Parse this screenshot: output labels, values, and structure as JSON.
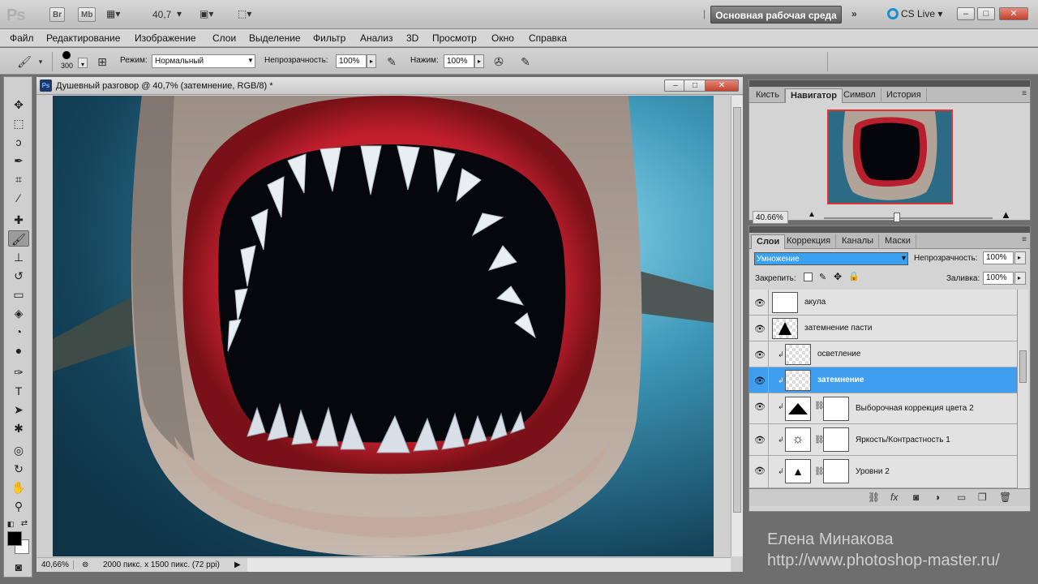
{
  "app": {
    "logo": "Ps",
    "bridge_badge": "Br",
    "mini_bridge_badge": "Mb",
    "zoom": "40,7",
    "workspace": "Основная рабочая среда",
    "cs_live": "CS Live"
  },
  "menu": [
    "Файл",
    "Редактирование",
    "Изображение",
    "Слои",
    "Выделение",
    "Фильтр",
    "Анализ",
    "3D",
    "Просмотр",
    "Окно",
    "Справка"
  ],
  "options": {
    "brush_size": "300",
    "mode_label": "Режим:",
    "mode_value": "Нормальный",
    "opacity_label": "Непрозрачность:",
    "opacity_value": "100%",
    "pressure_label": "Нажим:",
    "pressure_value": "100%"
  },
  "document": {
    "title": "Душевный разговор @ 40,7% (затемнение, RGB/8) *",
    "status_zoom": "40,66%",
    "status_info": "2000 пикс. x 1500 пикс. (72 ppi)"
  },
  "navigator_panel": {
    "tabs": [
      "Кисть",
      "Навигатор",
      "Символ",
      "История"
    ],
    "active_tab": "Навигатор",
    "zoom": "40.66%"
  },
  "layers_panel": {
    "tabs": [
      "Слои",
      "Коррекция",
      "Каналы",
      "Маски"
    ],
    "active_tab": "Слои",
    "blend_mode": "Умножение",
    "opacity_label": "Непрозрачность:",
    "opacity_value": "100%",
    "lock_label": "Закрепить:",
    "fill_label": "Заливка:",
    "fill_value": "100%",
    "layers": [
      {
        "name": "акула",
        "type": "pixel",
        "selected": false
      },
      {
        "name": "затемнение пасти",
        "type": "pixel",
        "selected": false
      },
      {
        "name": "осветление",
        "type": "clipped",
        "selected": false
      },
      {
        "name": "затемнение",
        "type": "clipped",
        "selected": true
      },
      {
        "name": "Выборочная коррекция цвета 2",
        "type": "adjustment",
        "selected": false
      },
      {
        "name": "Яркость/Контрастность 1",
        "type": "adjustment",
        "selected": false
      },
      {
        "name": "Уровни 2",
        "type": "adjustment",
        "selected": false
      }
    ]
  },
  "watermark": {
    "author": "Елена Минакова",
    "url": "http://www.photoshop-master.ru/"
  },
  "colors": {
    "selection_blue": "#3f9ef0",
    "close_red": "#c3422d"
  }
}
